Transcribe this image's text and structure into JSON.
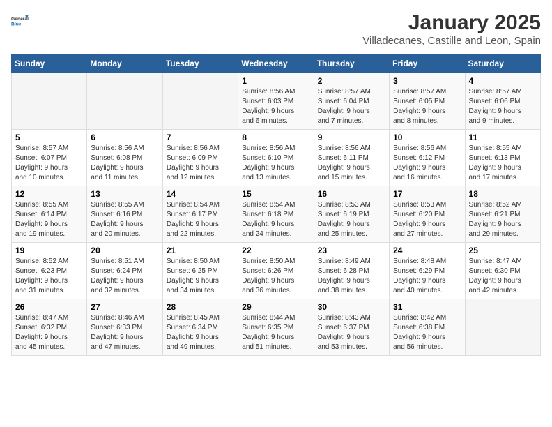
{
  "header": {
    "logo_general": "General",
    "logo_blue": "Blue",
    "month_title": "January 2025",
    "location": "Villadecanes, Castille and Leon, Spain"
  },
  "weekdays": [
    "Sunday",
    "Monday",
    "Tuesday",
    "Wednesday",
    "Thursday",
    "Friday",
    "Saturday"
  ],
  "weeks": [
    [
      {
        "day": "",
        "info": ""
      },
      {
        "day": "",
        "info": ""
      },
      {
        "day": "",
        "info": ""
      },
      {
        "day": "1",
        "info": "Sunrise: 8:56 AM\nSunset: 6:03 PM\nDaylight: 9 hours\nand 6 minutes."
      },
      {
        "day": "2",
        "info": "Sunrise: 8:57 AM\nSunset: 6:04 PM\nDaylight: 9 hours\nand 7 minutes."
      },
      {
        "day": "3",
        "info": "Sunrise: 8:57 AM\nSunset: 6:05 PM\nDaylight: 9 hours\nand 8 minutes."
      },
      {
        "day": "4",
        "info": "Sunrise: 8:57 AM\nSunset: 6:06 PM\nDaylight: 9 hours\nand 9 minutes."
      }
    ],
    [
      {
        "day": "5",
        "info": "Sunrise: 8:57 AM\nSunset: 6:07 PM\nDaylight: 9 hours\nand 10 minutes."
      },
      {
        "day": "6",
        "info": "Sunrise: 8:56 AM\nSunset: 6:08 PM\nDaylight: 9 hours\nand 11 minutes."
      },
      {
        "day": "7",
        "info": "Sunrise: 8:56 AM\nSunset: 6:09 PM\nDaylight: 9 hours\nand 12 minutes."
      },
      {
        "day": "8",
        "info": "Sunrise: 8:56 AM\nSunset: 6:10 PM\nDaylight: 9 hours\nand 13 minutes."
      },
      {
        "day": "9",
        "info": "Sunrise: 8:56 AM\nSunset: 6:11 PM\nDaylight: 9 hours\nand 15 minutes."
      },
      {
        "day": "10",
        "info": "Sunrise: 8:56 AM\nSunset: 6:12 PM\nDaylight: 9 hours\nand 16 minutes."
      },
      {
        "day": "11",
        "info": "Sunrise: 8:55 AM\nSunset: 6:13 PM\nDaylight: 9 hours\nand 17 minutes."
      }
    ],
    [
      {
        "day": "12",
        "info": "Sunrise: 8:55 AM\nSunset: 6:14 PM\nDaylight: 9 hours\nand 19 minutes."
      },
      {
        "day": "13",
        "info": "Sunrise: 8:55 AM\nSunset: 6:16 PM\nDaylight: 9 hours\nand 20 minutes."
      },
      {
        "day": "14",
        "info": "Sunrise: 8:54 AM\nSunset: 6:17 PM\nDaylight: 9 hours\nand 22 minutes."
      },
      {
        "day": "15",
        "info": "Sunrise: 8:54 AM\nSunset: 6:18 PM\nDaylight: 9 hours\nand 24 minutes."
      },
      {
        "day": "16",
        "info": "Sunrise: 8:53 AM\nSunset: 6:19 PM\nDaylight: 9 hours\nand 25 minutes."
      },
      {
        "day": "17",
        "info": "Sunrise: 8:53 AM\nSunset: 6:20 PM\nDaylight: 9 hours\nand 27 minutes."
      },
      {
        "day": "18",
        "info": "Sunrise: 8:52 AM\nSunset: 6:21 PM\nDaylight: 9 hours\nand 29 minutes."
      }
    ],
    [
      {
        "day": "19",
        "info": "Sunrise: 8:52 AM\nSunset: 6:23 PM\nDaylight: 9 hours\nand 31 minutes."
      },
      {
        "day": "20",
        "info": "Sunrise: 8:51 AM\nSunset: 6:24 PM\nDaylight: 9 hours\nand 32 minutes."
      },
      {
        "day": "21",
        "info": "Sunrise: 8:50 AM\nSunset: 6:25 PM\nDaylight: 9 hours\nand 34 minutes."
      },
      {
        "day": "22",
        "info": "Sunrise: 8:50 AM\nSunset: 6:26 PM\nDaylight: 9 hours\nand 36 minutes."
      },
      {
        "day": "23",
        "info": "Sunrise: 8:49 AM\nSunset: 6:28 PM\nDaylight: 9 hours\nand 38 minutes."
      },
      {
        "day": "24",
        "info": "Sunrise: 8:48 AM\nSunset: 6:29 PM\nDaylight: 9 hours\nand 40 minutes."
      },
      {
        "day": "25",
        "info": "Sunrise: 8:47 AM\nSunset: 6:30 PM\nDaylight: 9 hours\nand 42 minutes."
      }
    ],
    [
      {
        "day": "26",
        "info": "Sunrise: 8:47 AM\nSunset: 6:32 PM\nDaylight: 9 hours\nand 45 minutes."
      },
      {
        "day": "27",
        "info": "Sunrise: 8:46 AM\nSunset: 6:33 PM\nDaylight: 9 hours\nand 47 minutes."
      },
      {
        "day": "28",
        "info": "Sunrise: 8:45 AM\nSunset: 6:34 PM\nDaylight: 9 hours\nand 49 minutes."
      },
      {
        "day": "29",
        "info": "Sunrise: 8:44 AM\nSunset: 6:35 PM\nDaylight: 9 hours\nand 51 minutes."
      },
      {
        "day": "30",
        "info": "Sunrise: 8:43 AM\nSunset: 6:37 PM\nDaylight: 9 hours\nand 53 minutes."
      },
      {
        "day": "31",
        "info": "Sunrise: 8:42 AM\nSunset: 6:38 PM\nDaylight: 9 hours\nand 56 minutes."
      },
      {
        "day": "",
        "info": ""
      }
    ]
  ]
}
